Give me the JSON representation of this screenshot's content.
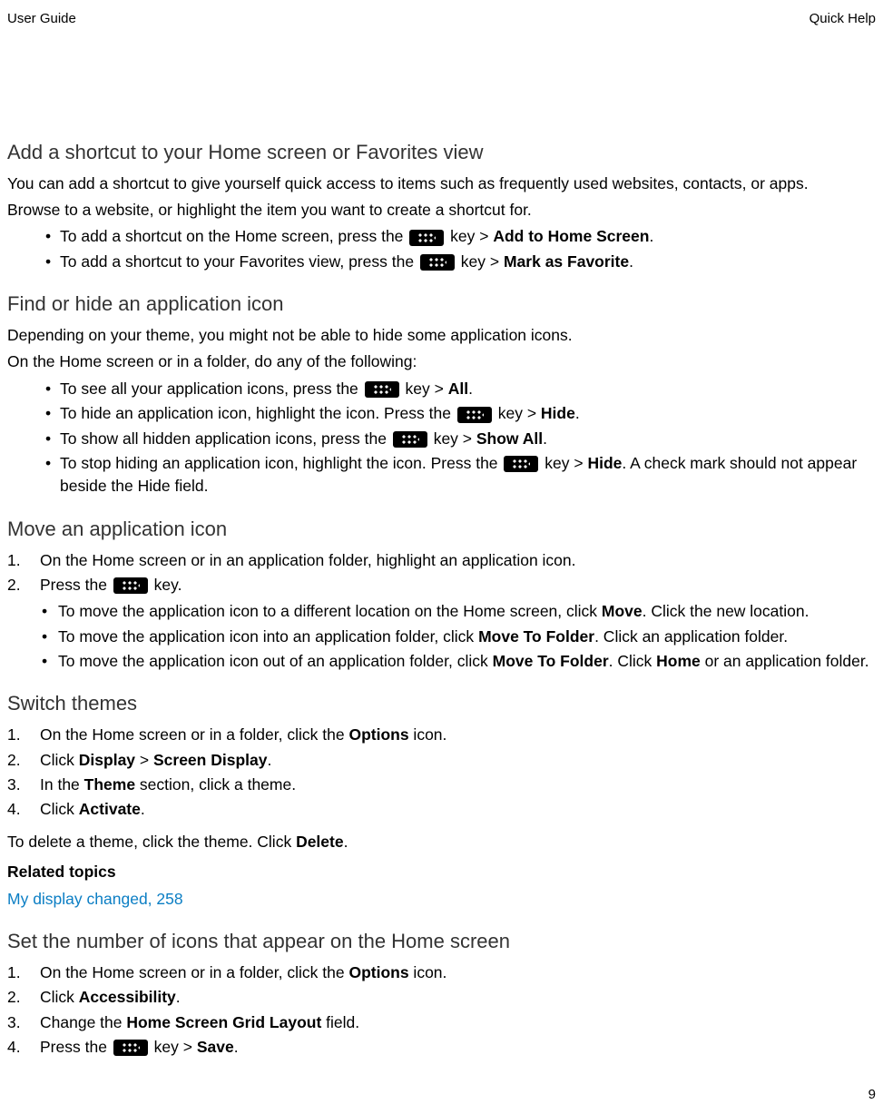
{
  "header": {
    "left": "User Guide",
    "right": "Quick Help"
  },
  "page_number": "9",
  "key_label": "key",
  "s1": {
    "title": "Add a shortcut to your Home screen or Favorites view",
    "p1": "You can add a shortcut to give yourself quick access to items such as frequently used websites, contacts, or apps.",
    "p2": "Browse to a website, or highlight the item you want to create a shortcut for.",
    "b1_pre": "To add a shortcut on the Home screen, press the ",
    "b1_mid": " > ",
    "b1_bold": "Add to Home Screen",
    "b1_end": ".",
    "b2_pre": "To add a shortcut to your Favorites view, press the ",
    "b2_mid": " > ",
    "b2_bold": "Mark as Favorite",
    "b2_end": "."
  },
  "s2": {
    "title": "Find or hide an application icon",
    "p1": "Depending on your theme, you might not be able to hide some application icons.",
    "p2": "On the Home screen or in a folder, do any of the following:",
    "b1_pre": "To see all your application icons, press the ",
    "b1_mid": " > ",
    "b1_bold": "All",
    "b1_end": ".",
    "b2_pre": "To hide an application icon, highlight the icon. Press the ",
    "b2_mid": " > ",
    "b2_bold": "Hide",
    "b2_end": ".",
    "b3_pre": "To show all hidden application icons, press the ",
    "b3_mid": " > ",
    "b3_bold": "Show All",
    "b3_end": ".",
    "b4_pre": "To stop hiding an application icon, highlight the icon. Press the ",
    "b4_mid": " > ",
    "b4_bold": "Hide",
    "b4_end": ". A check mark should not appear beside the Hide field."
  },
  "s3": {
    "title": "Move an application icon",
    "step1": "On the Home screen or in an application folder, highlight an application icon.",
    "step2_pre": "Press the ",
    "step2_post": " key.",
    "sub1_pre": "To move the application icon to a different location on the Home screen, click ",
    "sub1_b1": "Move",
    "sub1_post": ". Click the new location.",
    "sub2_pre": "To move the application icon into an application folder, click ",
    "sub2_b1": "Move To Folder",
    "sub2_post": ". Click an application folder.",
    "sub3_pre": "To move the application icon out of an application folder, click ",
    "sub3_b1": "Move To Folder",
    "sub3_mid": ". Click ",
    "sub3_b2": "Home",
    "sub3_post": " or an application folder."
  },
  "s4": {
    "title": "Switch themes",
    "step1_pre": "On the Home screen or in a folder, click the ",
    "step1_b": "Options",
    "step1_post": " icon.",
    "step2_pre": "Click ",
    "step2_b1": "Display",
    "step2_mid": " > ",
    "step2_b2": "Screen Display",
    "step2_post": ".",
    "step3_pre": "In the ",
    "step3_b": "Theme",
    "step3_post": " section, click a theme.",
    "step4_pre": "Click ",
    "step4_b": "Activate",
    "step4_post": ".",
    "after_pre": "To delete a theme, click the theme. Click ",
    "after_b": "Delete",
    "after_post": ".",
    "related_header": "Related topics",
    "related_link": "My display changed, 258"
  },
  "s5": {
    "title": "Set the number of icons that appear on the Home screen",
    "step1_pre": "On the Home screen or in a folder, click the ",
    "step1_b": "Options",
    "step1_post": " icon.",
    "step2_pre": "Click ",
    "step2_b": "Accessibility",
    "step2_post": ".",
    "step3_pre": "Change the ",
    "step3_b": "Home Screen Grid Layout",
    "step3_post": " field.",
    "step4_pre": "Press the ",
    "step4_mid": " > ",
    "step4_b": "Save",
    "step4_post": "."
  }
}
